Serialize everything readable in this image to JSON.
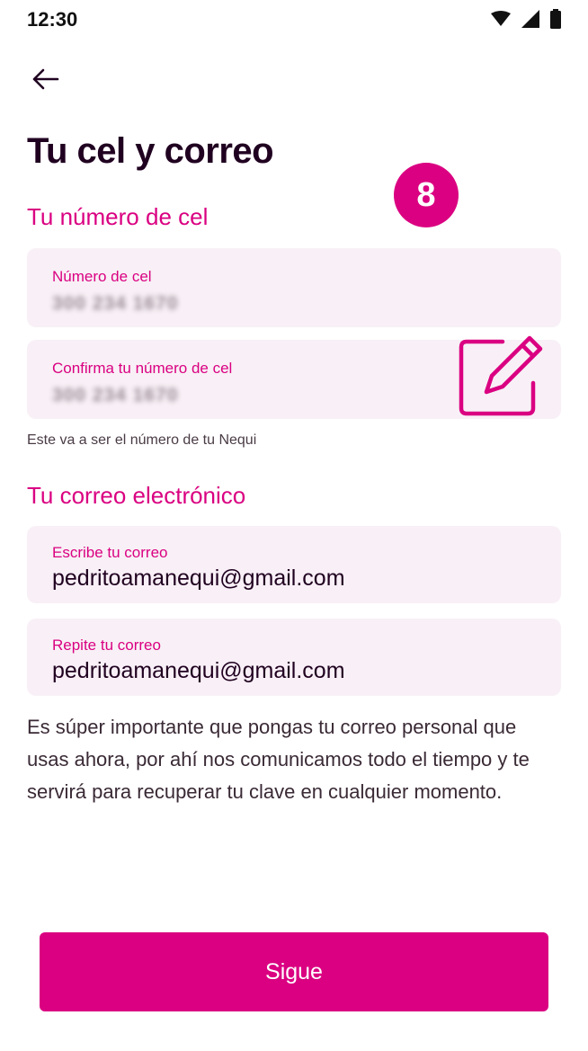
{
  "status_bar": {
    "time": "12:30",
    "icons": [
      "wifi-icon",
      "signal-icon",
      "battery-icon"
    ]
  },
  "header": {
    "back_icon": "arrow-left-icon",
    "title": "Tu cel y correo"
  },
  "step_badge": "8",
  "phone_section": {
    "title": "Tu número de cel",
    "phone_field": {
      "label": "Número de cel",
      "value": "300 234 1670"
    },
    "confirm_field": {
      "label": "Confirma tu número de cel",
      "value": "300 234 1670"
    },
    "helper": "Este va a ser el número de tu Nequi",
    "edit_icon": "pencil-square-icon"
  },
  "email_section": {
    "title": "Tu correo electrónico",
    "email_field": {
      "label": "Escribe tu correo",
      "value": "pedritoamanequi@gmail.com"
    },
    "repeat_field": {
      "label": "Repite tu correo",
      "value": "pedritoamanequi@gmail.com"
    },
    "info": "Es súper importante que pongas tu correo personal que usas ahora, por ahí nos comunicamos todo el tiempo y te servirá para recuperar tu clave en cualquier momento."
  },
  "actions": {
    "continue_label": "Sigue"
  },
  "colors": {
    "accent": "#da0081",
    "field_background": "#f8f0f6",
    "title_text": "#200020"
  }
}
